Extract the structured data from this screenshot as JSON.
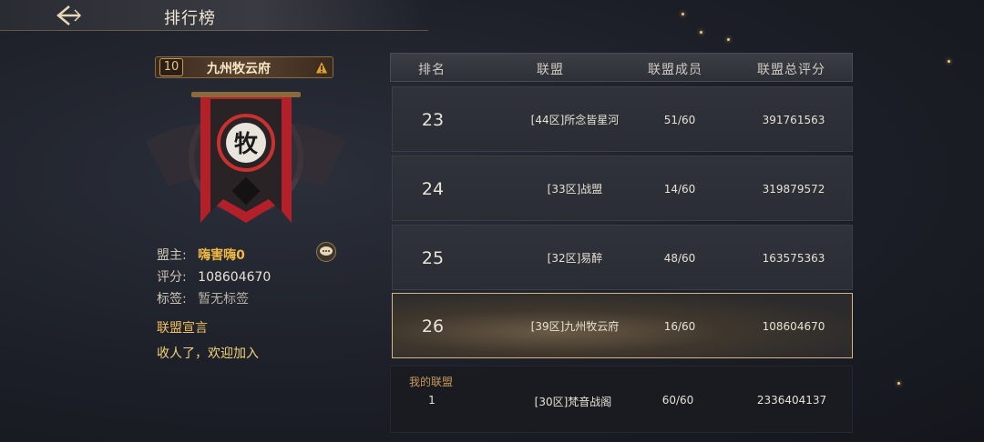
{
  "header": {
    "title": "排行榜",
    "back_icon": "back-arrow-icon"
  },
  "guild": {
    "level": "10",
    "name": "九州牧云府",
    "emblem_char": "牧",
    "leader_label": "盟主:",
    "leader_value": "嗨害嗨0",
    "score_label": "评分:",
    "score_value": "108604670",
    "tags_label": "标签:",
    "tags_value": "暂无标签",
    "declaration_title": "联盟宣言",
    "declaration_text": "收人了，欢迎加入"
  },
  "table": {
    "headers": {
      "rank": "排名",
      "name": "联盟",
      "members": "联盟成员",
      "total": "联盟总评分"
    },
    "rows": [
      {
        "rank": "23",
        "name": "[44区]所念皆星河",
        "members": "51/60",
        "total": "391761563"
      },
      {
        "rank": "24",
        "name": "[33区]战盟",
        "members": "14/60",
        "total": "319879572"
      },
      {
        "rank": "25",
        "name": "[32区]易醉",
        "members": "48/60",
        "total": "163575363"
      },
      {
        "rank": "26",
        "name": "[39区]九州牧云府",
        "members": "16/60",
        "total": "108604670"
      }
    ],
    "my_guild": {
      "label": "我的联盟",
      "rank": "1",
      "name": "[30区]梵音战阁",
      "members": "60/60",
      "total": "2336404137"
    }
  },
  "colors": {
    "accent": "#f0b845",
    "highlight_border": "#d6b780",
    "banner_red": "#b3202a"
  }
}
